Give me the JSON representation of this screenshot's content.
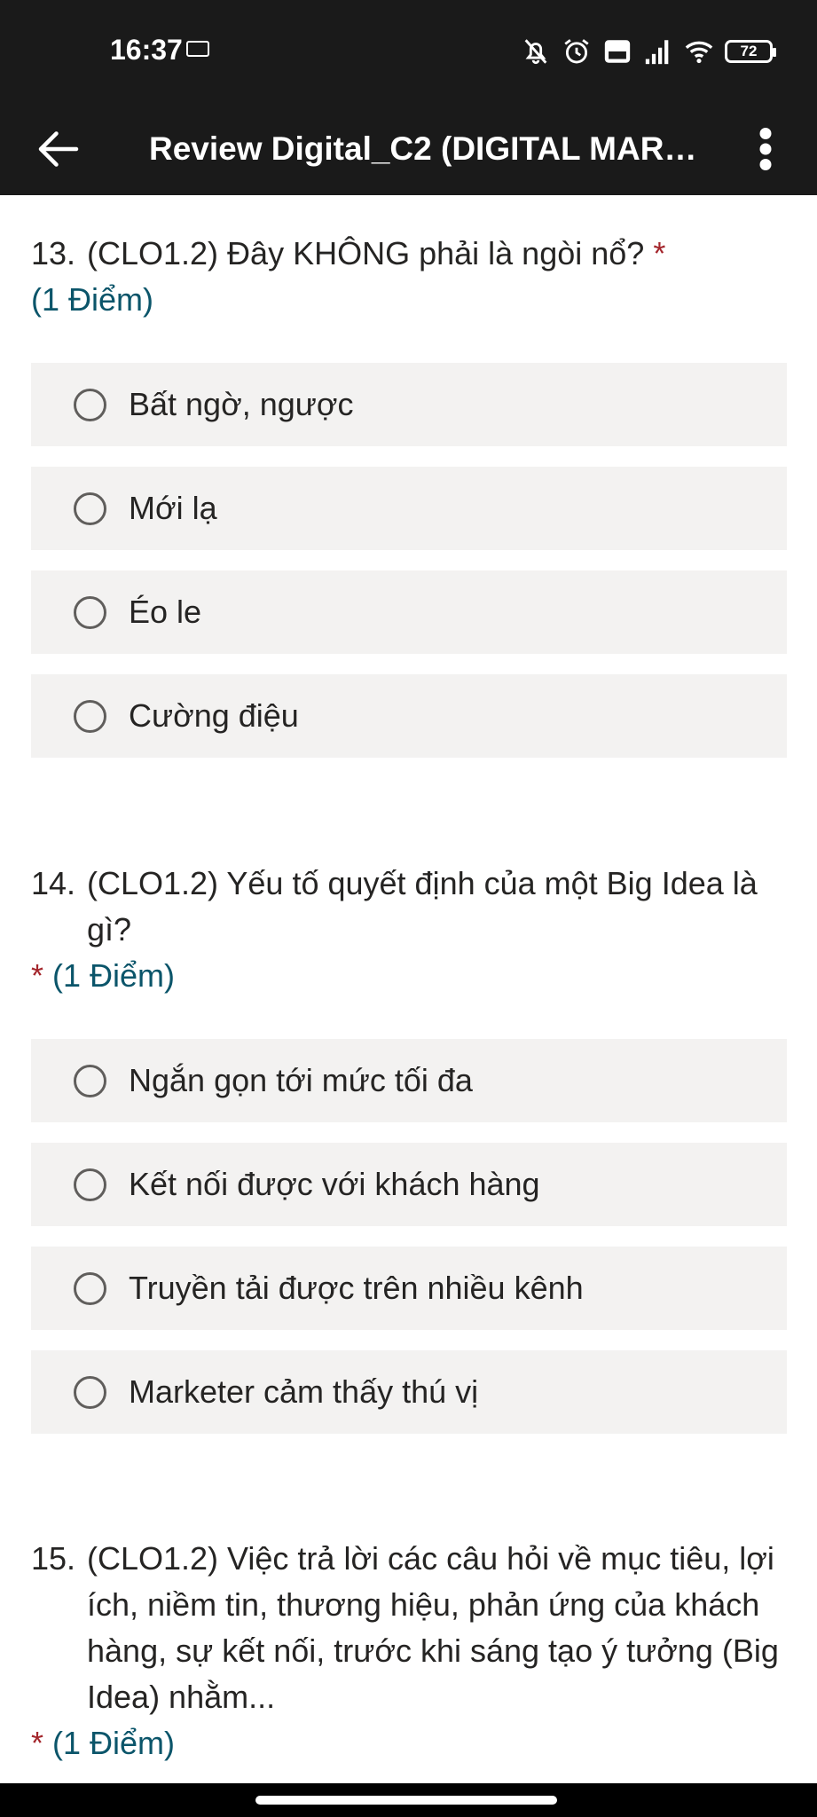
{
  "status_bar": {
    "time": "16:37",
    "battery": "72",
    "icons": [
      "muted-bell-icon",
      "alarm-icon",
      "volte-icon",
      "signal-icon",
      "wifi-icon",
      "battery-icon"
    ]
  },
  "app_bar": {
    "title": "Review Digital_C2 (DIGITAL MARKE..."
  },
  "questions": [
    {
      "number": "13.",
      "text": "(CLO1.2) Đây KHÔNG phải là ngòi nổ?",
      "required_mark": "*",
      "points": "(1 Điểm)",
      "options": [
        "Bất ngờ, ngược",
        "Mới lạ",
        "Éo le",
        "Cường điệu"
      ]
    },
    {
      "number": "14.",
      "text": "(CLO1.2) Yếu tố quyết định của một Big Idea là gì?",
      "required_mark": "*",
      "points": "(1 Điểm)",
      "options": [
        "Ngắn gọn tới mức tối đa",
        "Kết nối được với khách hàng",
        "Truyền tải được trên nhiều kênh",
        "Marketer cảm thấy thú vị"
      ]
    },
    {
      "number": "15.",
      "text": "(CLO1.2) Việc trả lời các câu hỏi về mục tiêu, lợi ích, niềm tin, thương hiệu, phản ứng của khách hàng, sự kết nối, trước khi sáng tạo ý tưởng (Big Idea) nhằm...",
      "required_mark": "*",
      "points": "(1 Điểm)",
      "options": []
    }
  ],
  "colors": {
    "bar_bg": "#1a1a1a",
    "option_bg": "#f3f2f1",
    "required": "#a4262c",
    "points": "#0b556a"
  }
}
